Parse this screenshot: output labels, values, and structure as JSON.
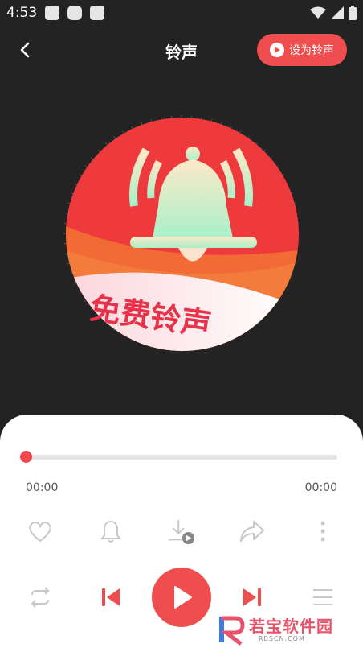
{
  "status_bar": {
    "time": "4:53"
  },
  "header": {
    "title": "铃声",
    "set_ringtone_label": "设为铃声"
  },
  "artwork": {
    "banner_text": "免费铃声"
  },
  "player": {
    "progress_fraction": 0,
    "current_time": "00:00",
    "total_time": "00:00"
  },
  "watermark": {
    "brand_text": "若宝软件园",
    "site_text": "RBSCN.COM"
  },
  "colors": {
    "accent": "#f04d4f",
    "background": "#232323",
    "panel": "#ffffff"
  },
  "icons": {
    "actions": [
      "heart-icon",
      "bell-icon",
      "download-icon",
      "share-icon",
      "more-icon"
    ],
    "controls": [
      "repeat-icon",
      "previous-icon",
      "play-icon",
      "next-icon",
      "playlist-icon"
    ]
  }
}
